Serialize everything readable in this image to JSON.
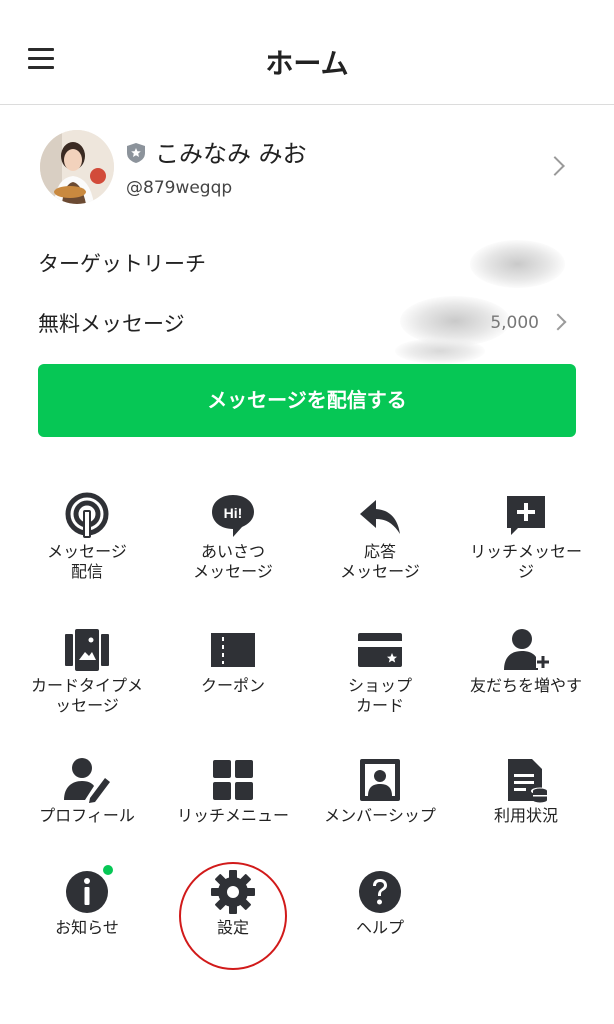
{
  "header": {
    "title": "ホーム"
  },
  "profile": {
    "name": "こみなみ みお",
    "id": "@879wegqp"
  },
  "stats": [
    {
      "label": "ターゲットリーチ",
      "value": ""
    },
    {
      "label": "無料メッセージ",
      "value": "5,000"
    }
  ],
  "cta": {
    "label": "メッセージを配信する"
  },
  "menu": [
    {
      "label": "メッセージ\n配信"
    },
    {
      "label": "あいさつ\nメッセージ"
    },
    {
      "label": "応答\nメッセージ"
    },
    {
      "label": "リッチメッセー\nジ"
    },
    {
      "label": "カードタイプメ\nッセージ"
    },
    {
      "label": "クーポン"
    },
    {
      "label": "ショップ\nカード"
    },
    {
      "label": "友だちを増やす"
    },
    {
      "label": "プロフィール"
    },
    {
      "label": "リッチメニュー"
    },
    {
      "label": "メンバーシップ"
    },
    {
      "label": "利用状況"
    },
    {
      "label": "お知らせ"
    },
    {
      "label": "設定"
    },
    {
      "label": "ヘルプ"
    }
  ],
  "colors": {
    "accent": "#06c755",
    "icon": "#2f3136",
    "highlight": "#d11a1a",
    "notification_dot": "#06c755"
  }
}
